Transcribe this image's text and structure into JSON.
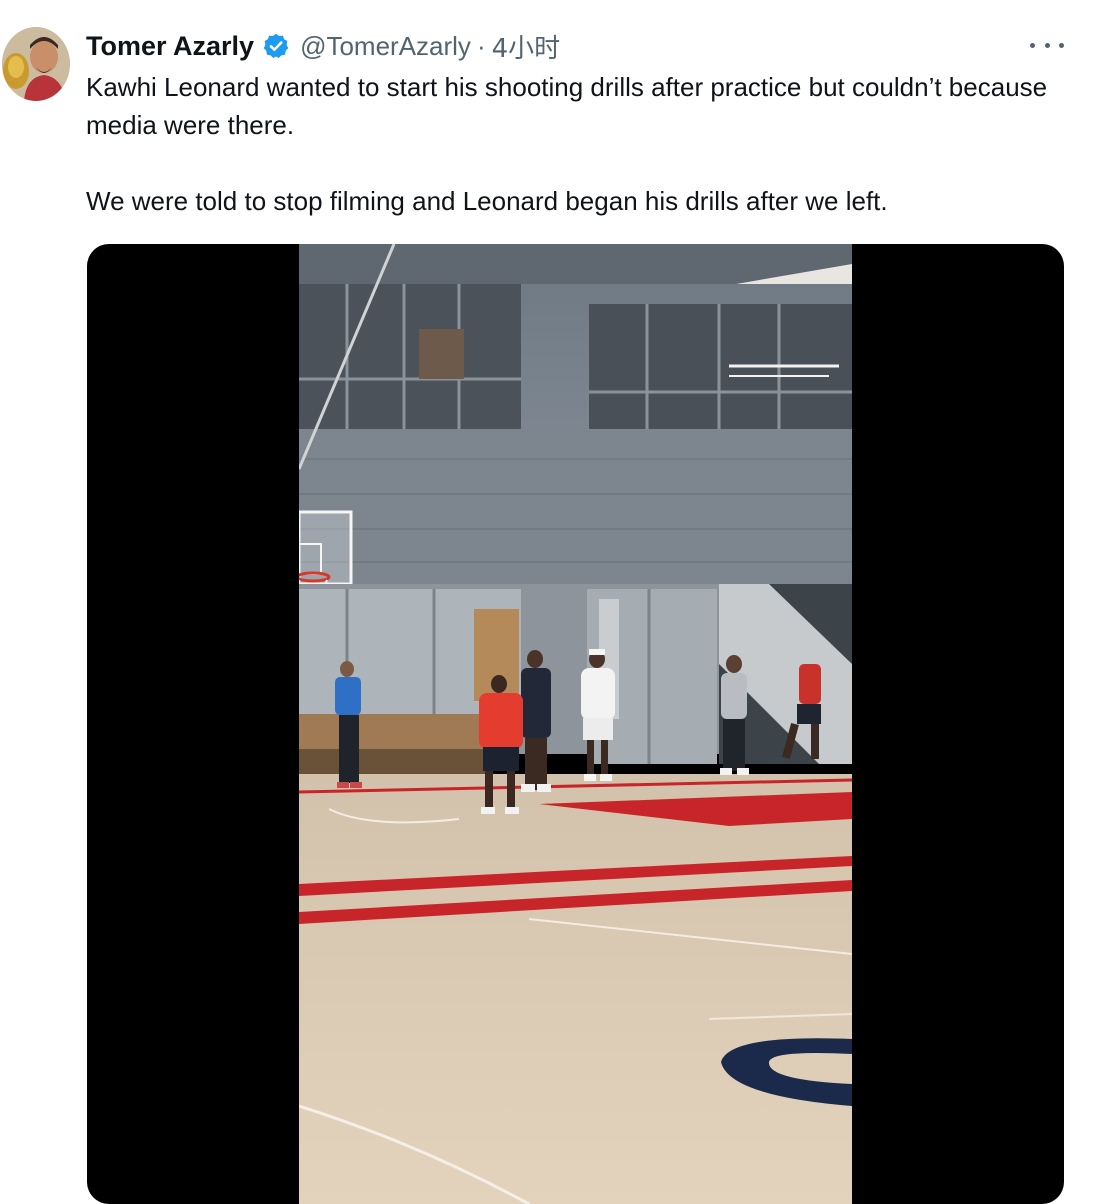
{
  "tweet": {
    "author": {
      "display_name": "Tomer Azarly",
      "handle": "@TomerAzarly",
      "verified": true
    },
    "separator": "·",
    "time": "4小时",
    "text_paragraphs": [
      "Kawhi Leonard wanted to start his shooting drills after practice but couldn’t because media were there.",
      "We were told to stop filming and Leonard began his drills after we left."
    ],
    "more_icon": "more-horizontal-icon",
    "media": {
      "type": "video",
      "description_icon": "video-frame"
    }
  },
  "colors": {
    "verified_blue": "#1d9bf0",
    "secondary_text": "#536471",
    "court_red": "#c8252b",
    "court_navy": "#1b2a4a"
  }
}
